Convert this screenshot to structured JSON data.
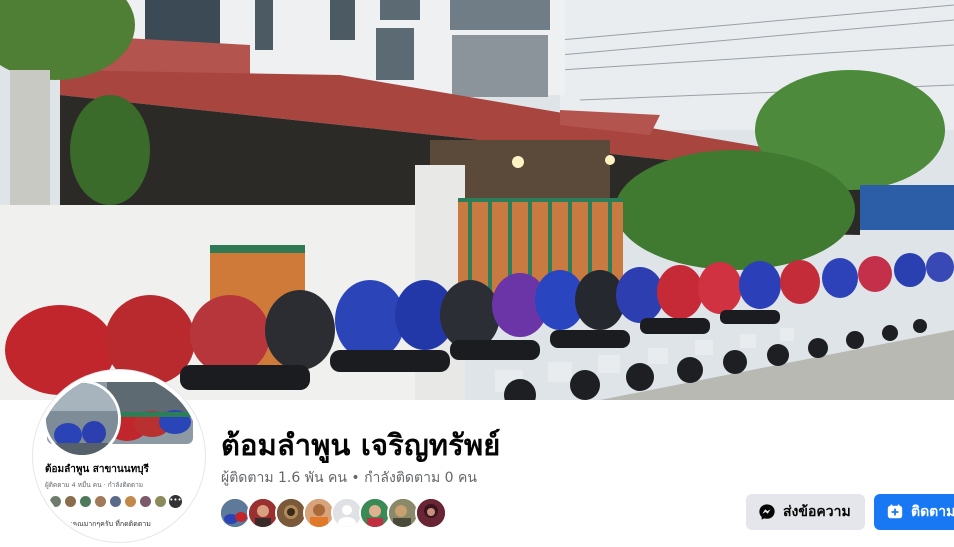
{
  "page": {
    "name": "ต้อมลำพูน เจริญทรัพย์",
    "stats": "ผู้ติดตาม 1.6 พัน คน • กำลังติดตาม 0 คน"
  },
  "avatar": {
    "name": "ต้อมลำพูน สาขานนทบุรี",
    "followers": "ผู้ติดตาม 4 หมื่น คน · กำลังติดตาม",
    "cta": "ขอบคุณมากๆครับ ที่กดติดตาม"
  },
  "actions": {
    "message_label": "ส่งข้อความ",
    "follow_label": "ติดตาม"
  },
  "colors": {
    "primary": "#1877f2",
    "secondary_button": "#e4e6eb",
    "text_primary": "#050505",
    "text_secondary": "#65676b"
  },
  "icons": {
    "message": "messenger-icon",
    "follow": "follow-icon"
  }
}
